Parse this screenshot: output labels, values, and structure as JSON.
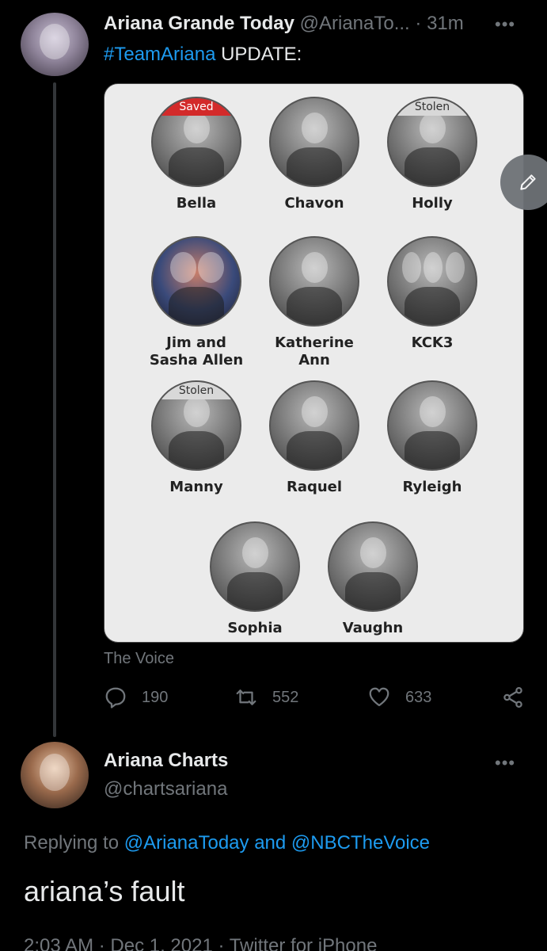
{
  "tweet": {
    "author_name": "Ariana Grande Today",
    "handle": "@ArianaTo...",
    "separator": "·",
    "time": "31m",
    "hashtag": "#TeamAriana",
    "text": " UPDATE:",
    "source": "The Voice",
    "stats": {
      "replies": "190",
      "retweets": "552",
      "likes": "633"
    },
    "card": {
      "contestants": [
        {
          "name": "Bella",
          "badge": "Saved"
        },
        {
          "name": "Chavon",
          "badge": ""
        },
        {
          "name": "Holly",
          "badge": "Stolen"
        },
        {
          "name": "Jim and\nSasha Allen",
          "badge": ""
        },
        {
          "name": "Katherine\nAnn",
          "badge": ""
        },
        {
          "name": "KCK3",
          "badge": ""
        },
        {
          "name": "Manny",
          "badge": "Stolen"
        },
        {
          "name": "Raquel",
          "badge": ""
        },
        {
          "name": "Ryleigh",
          "badge": ""
        },
        {
          "name": "Sophia",
          "badge": ""
        },
        {
          "name": "Vaughn",
          "badge": ""
        }
      ]
    }
  },
  "reply": {
    "author_name": "Ariana Charts",
    "handle": "@chartsariana",
    "replying_prefix": "Replying to ",
    "mention_1": "@ArianaToday",
    "and": " and ",
    "mention_2": "@NBCTheVoice",
    "text": "ariana’s fault",
    "meta": "2:03 AM · Dec 1, 2021 · Twitter for iPhone"
  },
  "icons": {
    "more": "more-dots-icon",
    "reply": "reply-icon",
    "retweet": "retweet-icon",
    "like": "heart-icon",
    "share": "share-icon",
    "compose": "pencil-icon"
  },
  "colors": {
    "background": "#000000",
    "link": "#1d9bf0",
    "muted": "#71767b",
    "saved": "#d32a2a"
  }
}
